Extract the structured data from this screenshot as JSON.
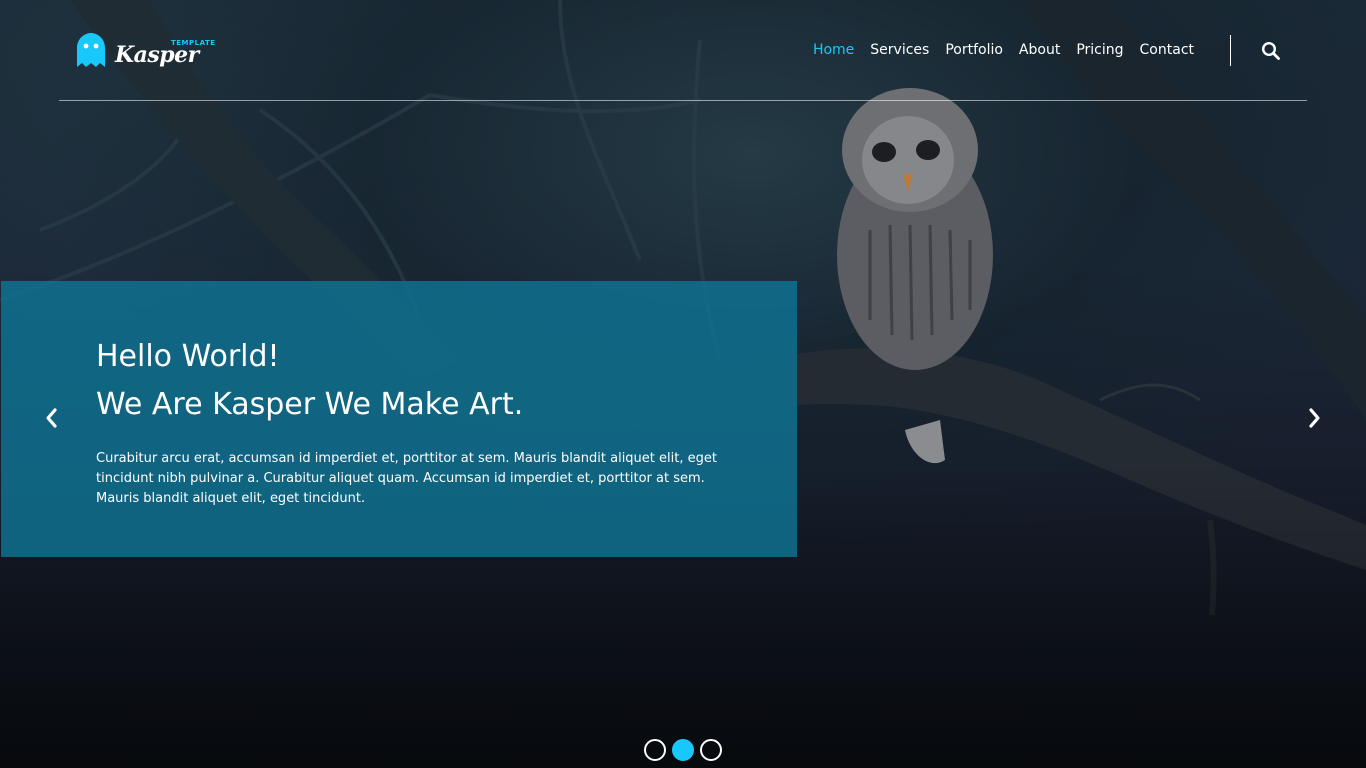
{
  "brand": {
    "template_label": "TEMPLATE",
    "name": "Kasper",
    "accent_color": "#19c8fa"
  },
  "nav": {
    "items": [
      {
        "label": "Home",
        "active": true
      },
      {
        "label": "Services",
        "active": false
      },
      {
        "label": "Portfolio",
        "active": false
      },
      {
        "label": "About",
        "active": false
      },
      {
        "label": "Pricing",
        "active": false
      },
      {
        "label": "Contact",
        "active": false
      }
    ],
    "search_icon": "search-icon"
  },
  "hero": {
    "heading_line1": "Hello World!",
    "heading_line2": "We Are Kasper We Make Art.",
    "paragraph": "Curabitur arcu erat, accumsan id imperdiet et, porttitor at sem. Mauris blandit aliquet elit, eget tincidunt nibh pulvinar a. Curabitur aliquet quam. Accumsan id imperdiet et, porttitor at sem. Mauris blandit aliquet elit, eget tincidunt.",
    "box_color": "#0f7494",
    "prev_icon": "chevron-left-icon",
    "next_icon": "chevron-right-icon"
  },
  "slider": {
    "bullet_count": 3,
    "active_index": 1
  }
}
